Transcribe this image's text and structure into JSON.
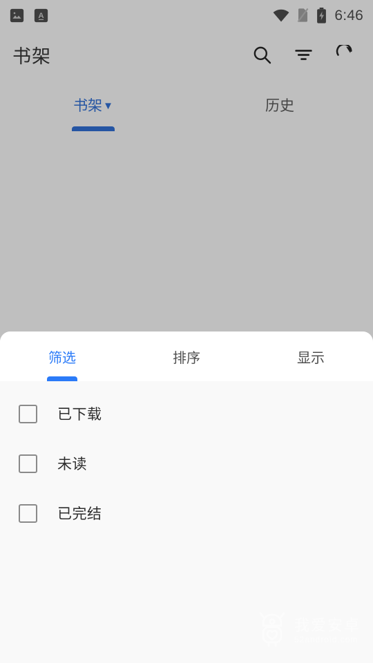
{
  "status_bar": {
    "time": "6:46",
    "left_icons": [
      {
        "name": "image-notification-icon",
        "glyph": "▰"
      },
      {
        "name": "font-notification-icon",
        "glyph": "A"
      }
    ],
    "right_icons": [
      {
        "name": "wifi-icon"
      },
      {
        "name": "no-sim-icon"
      },
      {
        "name": "battery-charging-icon"
      }
    ]
  },
  "toolbar": {
    "title": "书架",
    "actions": [
      {
        "name": "search-icon",
        "label": "搜索"
      },
      {
        "name": "filter-icon",
        "label": "筛选"
      },
      {
        "name": "refresh-icon",
        "label": "刷新"
      }
    ]
  },
  "main_tabs": {
    "items": [
      {
        "label": "书架",
        "caret": "▼",
        "active": true
      },
      {
        "label": "历史",
        "caret": "",
        "active": false
      }
    ]
  },
  "bottom_sheet": {
    "tabs": [
      {
        "label": "筛选",
        "active": true
      },
      {
        "label": "排序",
        "active": false
      },
      {
        "label": "显示",
        "active": false
      }
    ],
    "filters": [
      {
        "label": "已下载",
        "checked": false
      },
      {
        "label": "未读",
        "checked": false
      },
      {
        "label": "已完结",
        "checked": false
      }
    ]
  },
  "watermark": {
    "main": "我爱安卓",
    "sub": "52android.com"
  },
  "colors": {
    "accent_blue": "#2b7bf8",
    "scrim": "#ababab",
    "sheet_bg": "#f9f9f9",
    "tabbar_bg": "#ffffff",
    "text_primary": "#2e2e2e"
  }
}
